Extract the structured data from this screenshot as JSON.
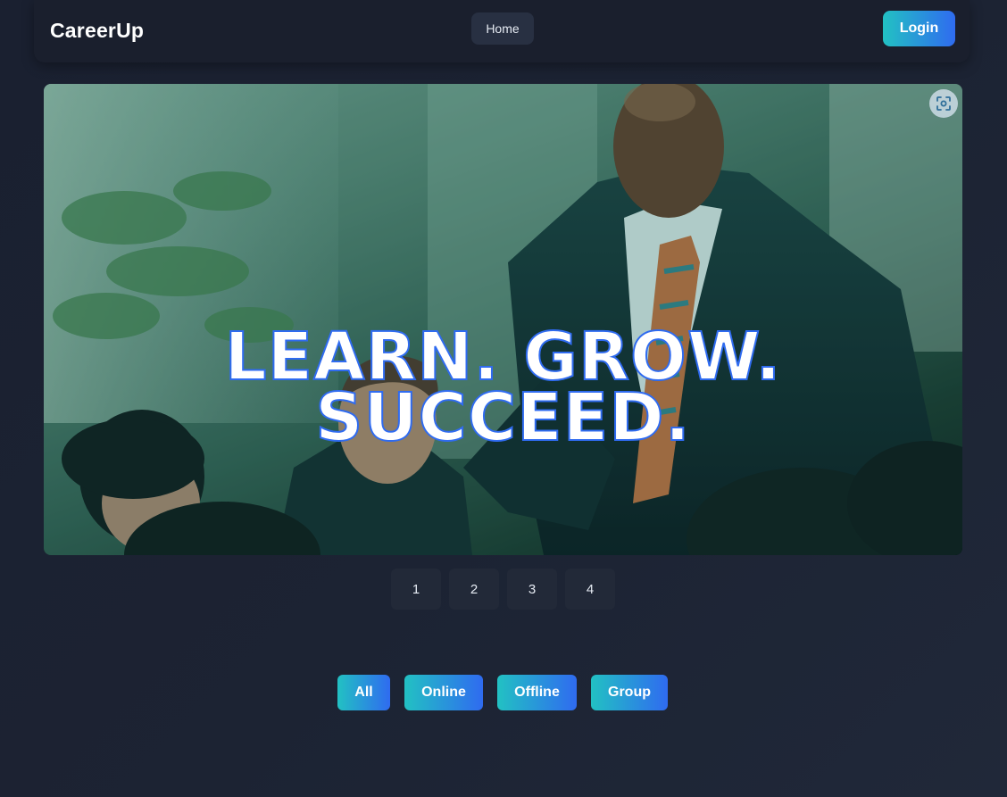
{
  "navbar": {
    "brand": "CareerUp",
    "home_label": "Home",
    "login_label": "Login"
  },
  "hero": {
    "title_line1": "LEARN. GROW.",
    "title_line2": "SUCCEED.",
    "scan_icon": "scan-icon"
  },
  "pagination": {
    "pages": [
      "1",
      "2",
      "3",
      "4"
    ]
  },
  "filters": {
    "items": [
      "All",
      "Online",
      "Offline",
      "Group"
    ]
  },
  "colors": {
    "background": "#1b2130",
    "navbar": "#1a1f2d",
    "accent_start": "#22c1c3",
    "accent_end": "#2f6bf0"
  }
}
